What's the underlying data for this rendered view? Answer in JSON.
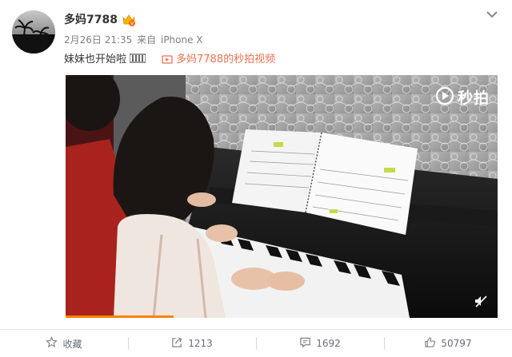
{
  "post": {
    "username": "多妈7788",
    "date": "2月26日 21:35",
    "source_prefix": "来自",
    "source": "iPhone X",
    "text": "妹妹也开始啦",
    "video_link": "多妈7788的秒拍视频"
  },
  "video": {
    "watermark": "秒拍",
    "progress": 0.25
  },
  "actions": {
    "favorite": "收藏",
    "share": "1213",
    "comment": "1692",
    "like": "50797"
  },
  "colors": {
    "link": "#eb7350",
    "progress": "#ff8200",
    "action_text": "#696e78",
    "meta_text": "#808080"
  },
  "icons": [
    "vip-crown-icon",
    "chevron-down-icon",
    "video-icon",
    "miaopai-icon",
    "mute-icon",
    "star-icon",
    "share-icon",
    "comment-icon",
    "like-icon"
  ]
}
